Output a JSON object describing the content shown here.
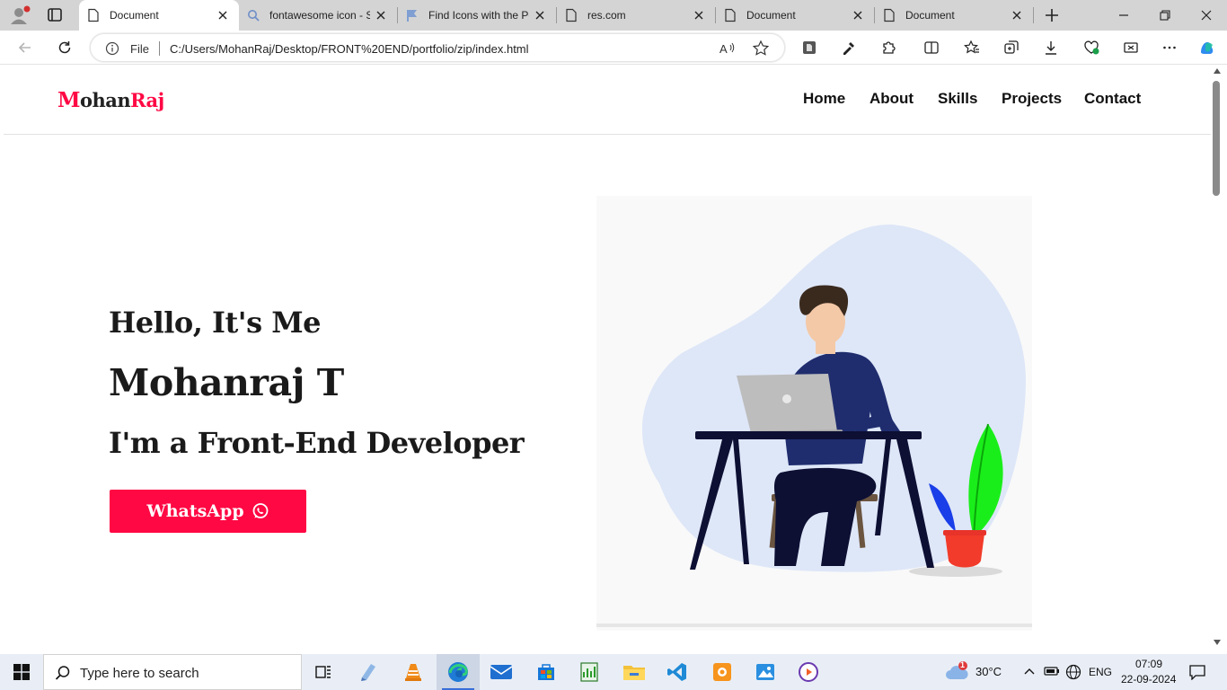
{
  "browser": {
    "tabs": [
      {
        "title": "Document",
        "icon": "page-icon",
        "active": true
      },
      {
        "title": "fontawesome icon - S",
        "icon": "search-icon",
        "active": false
      },
      {
        "title": "Find Icons with the Pe",
        "icon": "flag-icon",
        "active": false
      },
      {
        "title": "res.com",
        "icon": "page-icon",
        "active": false
      },
      {
        "title": "Document",
        "icon": "page-icon",
        "active": false
      },
      {
        "title": "Document",
        "icon": "page-icon",
        "active": false
      }
    ],
    "address": {
      "protocol_label": "File",
      "url": "C:/Users/MohanRaj/Desktop/FRONT%20END/portfolio/zip/index.html"
    }
  },
  "page": {
    "logo": {
      "m": "M",
      "ohan": "ohan",
      "raj": "Raj"
    },
    "nav": [
      "Home",
      "About",
      "Skills",
      "Projects",
      "Contact"
    ],
    "hero": {
      "greeting": "Hello, It's Me",
      "name": "Mohanraj T",
      "role": "I'm a Front-End Developer",
      "cta_label": "WhatsApp"
    },
    "colors": {
      "accent": "#ff0844",
      "text": "#1a1a1a"
    }
  },
  "taskbar": {
    "search_placeholder": "Type here to search",
    "weather_temp": "30°C",
    "weather_badge": "1",
    "language": "ENG",
    "time": "07:09",
    "date": "22-09-2024"
  }
}
